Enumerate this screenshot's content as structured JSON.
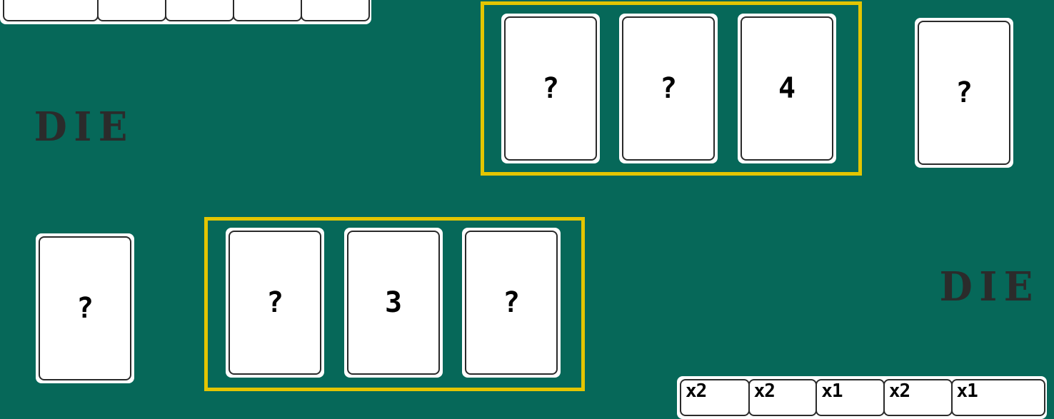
{
  "opponent_hand": {
    "slots": [
      "",
      "",
      "",
      "",
      ""
    ]
  },
  "opponent": {
    "status_label": "DIE",
    "row_cards": [
      "?",
      "?",
      "4"
    ],
    "single_card": "?"
  },
  "player": {
    "status_label": "DIE",
    "single_card": "?",
    "row_cards": [
      "?",
      "3",
      "?"
    ]
  },
  "player_hand": {
    "slots": [
      "x2",
      "x2",
      "x1",
      "x2",
      "x1"
    ]
  },
  "colors": {
    "table": "#066859",
    "highlight_frame": "#e3c500",
    "card_face": "#ffffff",
    "status_text": "#2b2b2b"
  }
}
